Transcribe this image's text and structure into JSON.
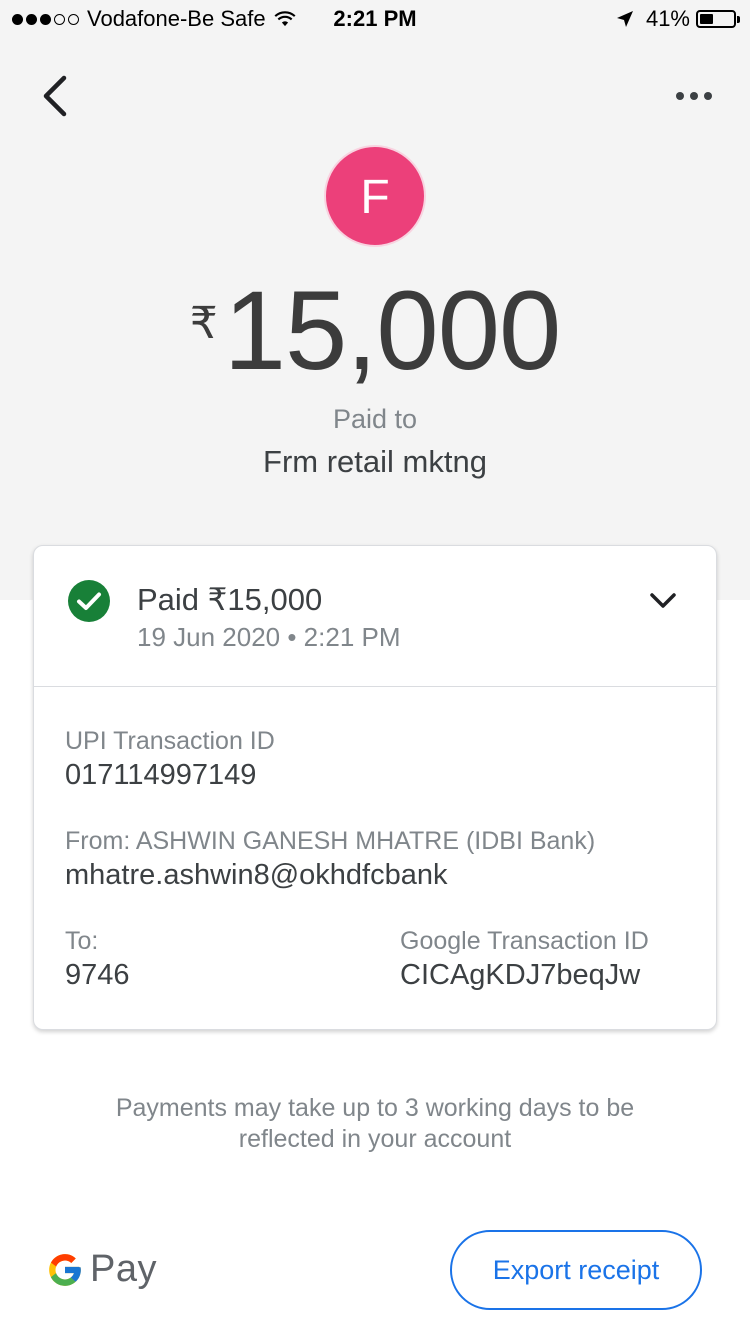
{
  "status_bar": {
    "carrier": "Vodafone-Be Safe",
    "time": "2:21 PM",
    "battery": "41%",
    "battery_level": 0.41,
    "signal_bars_filled": 3,
    "signal_bars_total": 5
  },
  "header": {
    "back_icon": "arrow-back-icon",
    "more_icon": "more-horizontal-icon"
  },
  "payee": {
    "avatar_letter": "F",
    "avatar_color": "#ec407a",
    "paid_to_label": "Paid to",
    "name": "Frm retail mktng"
  },
  "amount": {
    "currency_symbol": "₹",
    "value": "15,000"
  },
  "card": {
    "status_title": "Paid ₹15,000",
    "date": "19 Jun 2020 • 2:21 PM",
    "status_color": "#188038",
    "upi_label": "UPI Transaction ID",
    "upi_value": "017114997149",
    "from_label": "From: ASHWIN GANESH MHATRE (IDBI Bank)",
    "from_value": "mhatre.ashwin8@okhdfcbank",
    "to_label": "To:",
    "to_value": "9746",
    "google_txn_label": "Google Transaction ID",
    "google_txn_value": "CICAgKDJ7beqJw"
  },
  "notice": "Payments may take up to 3 working days to be reflected in your account",
  "footer": {
    "brand_text": "Pay",
    "export_label": "Export receipt",
    "accent_color": "#1a73e8"
  }
}
